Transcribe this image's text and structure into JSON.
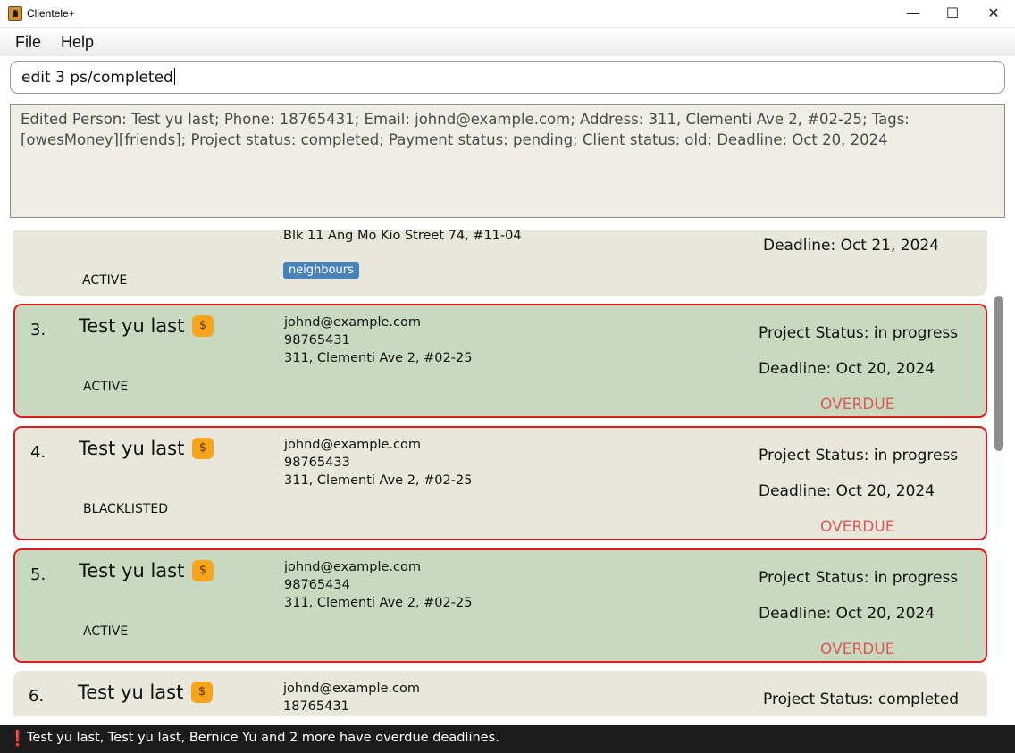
{
  "window": {
    "title": "Clientele+",
    "minimize": "—",
    "maximize": "☐",
    "close": "✕"
  },
  "menu": {
    "file": "File",
    "help": "Help"
  },
  "command": {
    "value": "edit 3 ps/completed"
  },
  "result": {
    "text": "Edited Person: Test yu last; Phone: 18765431; Email: johnd@example.com; Address: 311, Clementi Ave 2, #02-25; Tags: [owesMoney][friends]; Project status: completed; Payment status: pending; Client status: old; Deadline: Oct 20, 2024"
  },
  "cards": {
    "partial_top": {
      "address": "Blk 11 Ang Mo Kio Street 74, #11-04",
      "tag": "neighbours",
      "client_status": "ACTIVE",
      "deadline": "Deadline: Oct 21, 2024"
    },
    "c3": {
      "index": "3.",
      "name": "Test yu last",
      "badge": "$",
      "email": "johnd@example.com",
      "phone": "98765431",
      "address": "311, Clementi Ave 2, #02-25",
      "client_status": "ACTIVE",
      "project_status": "Project Status: in progress",
      "deadline": "Deadline: Oct 20, 2024",
      "overdue": "OVERDUE"
    },
    "c4": {
      "index": "4.",
      "name": "Test yu last",
      "badge": "$",
      "email": "johnd@example.com",
      "phone": "98765433",
      "address": "311, Clementi Ave 2, #02-25",
      "client_status": "BLACKLISTED",
      "project_status": "Project Status: in progress",
      "deadline": "Deadline: Oct 20, 2024",
      "overdue": "OVERDUE"
    },
    "c5": {
      "index": "5.",
      "name": "Test yu last",
      "badge": "$",
      "email": "johnd@example.com",
      "phone": "98765434",
      "address": "311, Clementi Ave 2, #02-25",
      "client_status": "ACTIVE",
      "project_status": "Project Status: in progress",
      "deadline": "Deadline: Oct 20, 2024",
      "overdue": "OVERDUE"
    },
    "c6": {
      "index": "6.",
      "name": "Test yu last",
      "badge": "$",
      "email": "johnd@example.com",
      "phone": "18765431",
      "project_status": "Project Status: completed"
    }
  },
  "status_bar": {
    "icon": "warning-icon",
    "symbol": "❗",
    "text": "Test yu last, Test yu last, Bernice Yu and 2 more have overdue deadlines."
  },
  "colors": {
    "card_default": "#e8e7dc",
    "card_alt": "#c9d9bf",
    "overdue_border": "#e0191b",
    "overdue_text": "#d65a5a",
    "payment_badge": "#f8a51c",
    "tag_bg": "#4a82b8",
    "status_bar_bg": "#1c1c1c"
  }
}
